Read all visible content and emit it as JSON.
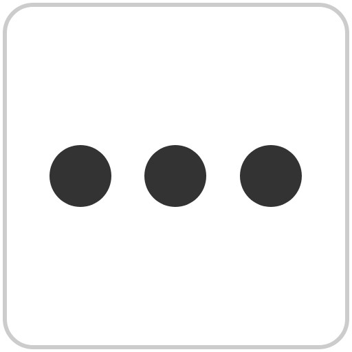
{
  "icon": "more-horizontal-icon",
  "colors": {
    "border": "#cccccc",
    "background": "#ffffff",
    "dot": "#333333"
  }
}
